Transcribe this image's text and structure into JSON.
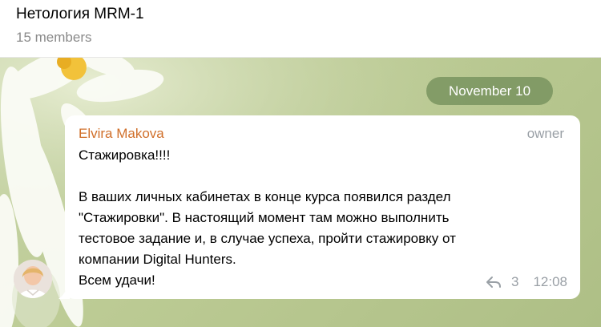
{
  "header": {
    "title": "Нетология MRM-1",
    "subtitle": "15 members"
  },
  "date_separator": "November 10",
  "message": {
    "sender": "Elvira Makova",
    "role": "owner",
    "line1": "Стажировка!!!!",
    "line2": "В ваших личных кабинетах в конце курса появился раздел",
    "line3": "\"Стажировки\". В настоящий момент там можно выполнить",
    "line4": "тестовое задание и, в случае успеха, пройти стажировку от",
    "line5": "компании Digital Hunters.",
    "line6": "Всем удачи!",
    "reply_count": "3",
    "time": "12:08",
    "reply_icon": "reply-arrow-icon",
    "sender_color": "#d06f2a"
  },
  "avatar": {
    "icon": "user-avatar-photo"
  }
}
